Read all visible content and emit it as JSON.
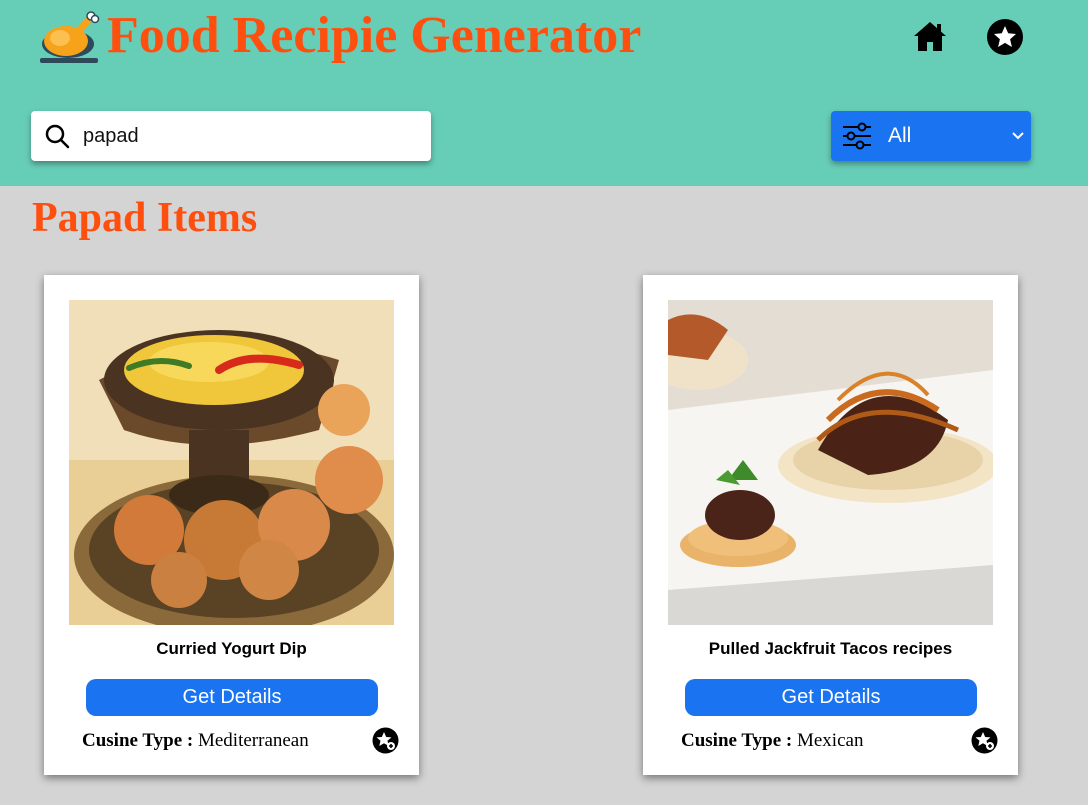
{
  "header": {
    "title": "Food Recipie Generator",
    "logo_icon": "roast-chicken-icon",
    "nav": [
      {
        "icon": "home-icon"
      },
      {
        "icon": "star-circle-icon"
      }
    ]
  },
  "search": {
    "value": "papad",
    "icon": "search-icon"
  },
  "filter": {
    "icon": "sliders-icon",
    "selected": "All"
  },
  "section_title": "Papad Items",
  "cards": [
    {
      "title": "Curried Yogurt Dip",
      "button": "Get Details",
      "cuisine_label": "Cusine Type :",
      "cuisine_value": "Mediterranean",
      "image": "curried-yogurt-dip-photo"
    },
    {
      "title": "Pulled Jackfruit Tacos recipes",
      "button": "Get Details",
      "cuisine_label": "Cusine Type :",
      "cuisine_value": "Mexican",
      "image": "jackfruit-tacos-photo"
    }
  ],
  "colors": {
    "header_bg": "#66cdb7",
    "page_bg": "#d4d4d4",
    "accent_orange": "#ff4f0f",
    "button_blue": "#1a73f0"
  }
}
